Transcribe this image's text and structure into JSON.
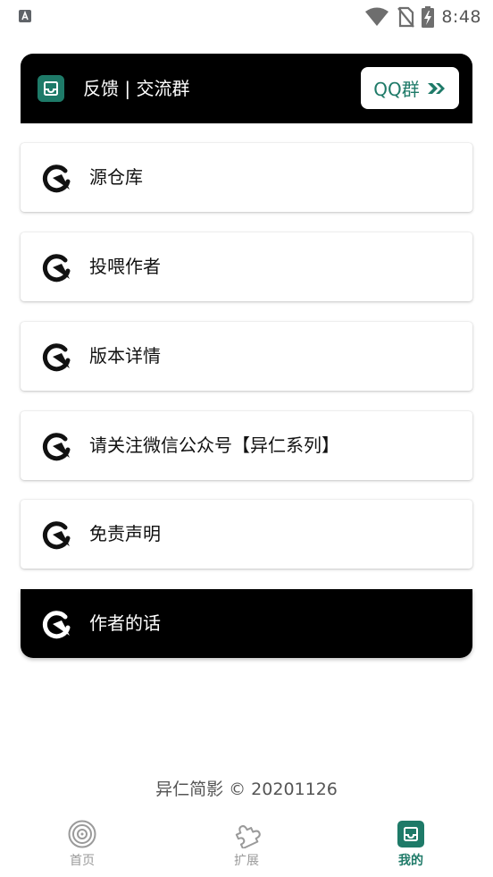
{
  "status_bar": {
    "time": "8:48",
    "left_icon": "a-square-icon",
    "right_icons": [
      "wifi-icon",
      "no-sim-icon",
      "battery-charging-icon"
    ]
  },
  "header": {
    "icon": "inbox-icon",
    "title": "反馈 | 交流群",
    "qq_button_label": "QQ群",
    "qq_button_icon": "double-arrow-icon"
  },
  "menu": [
    {
      "label": "源仓库",
      "icon": "redo-arrow-icon",
      "dark": false
    },
    {
      "label": "投喂作者",
      "icon": "redo-arrow-icon",
      "dark": false
    },
    {
      "label": "版本详情",
      "icon": "redo-arrow-icon",
      "dark": false
    },
    {
      "label": "请关注微信公众号【异仁系列】",
      "icon": "redo-arrow-icon",
      "dark": false
    },
    {
      "label": "免责声明",
      "icon": "redo-arrow-icon",
      "dark": false
    },
    {
      "label": "作者的话",
      "icon": "redo-arrow-icon",
      "dark": true
    }
  ],
  "footer": {
    "text": "异仁简影 © 20201126"
  },
  "bottom_nav": {
    "items": [
      {
        "label": "首页",
        "icon": "record-icon",
        "active": false
      },
      {
        "label": "扩展",
        "icon": "puzzle-icon",
        "active": false
      },
      {
        "label": "我的",
        "icon": "inbox-icon",
        "active": true
      }
    ]
  },
  "colors": {
    "accent": "#1e7a68",
    "header_bg": "#000000",
    "inactive_nav": "#9a9a9a"
  }
}
